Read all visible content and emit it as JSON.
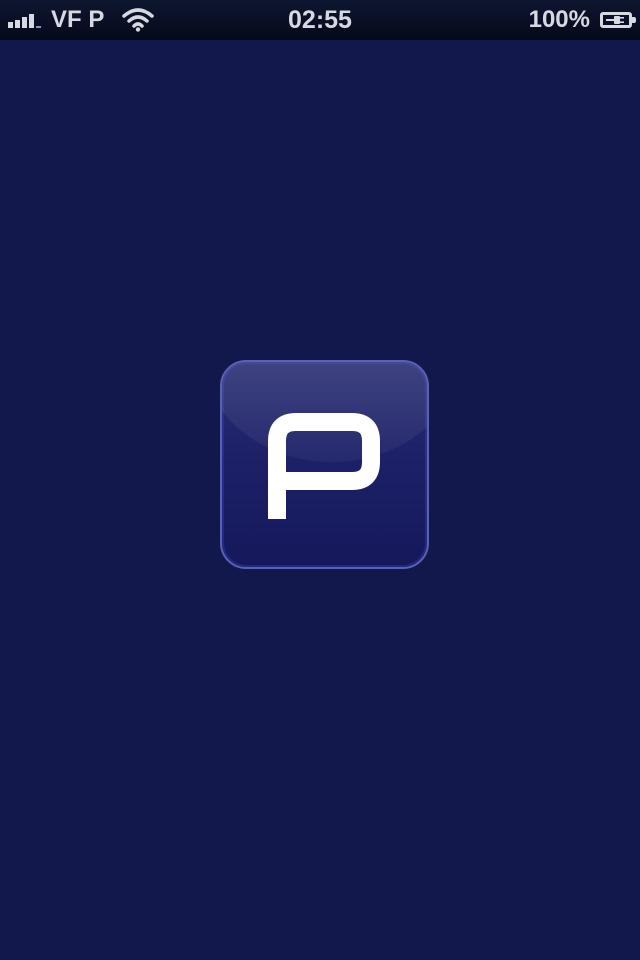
{
  "status_bar": {
    "carrier": "VF P",
    "time": "02:55",
    "battery_percent": "100%",
    "signal_bars": 4,
    "icons": {
      "signal": "signal-strength-icon",
      "wifi": "wifi-icon",
      "battery": "battery-charging-icon"
    }
  },
  "splash": {
    "background_color": "#13184c",
    "logo": {
      "letter": "P",
      "icon_name": "app-logo-icon"
    }
  }
}
